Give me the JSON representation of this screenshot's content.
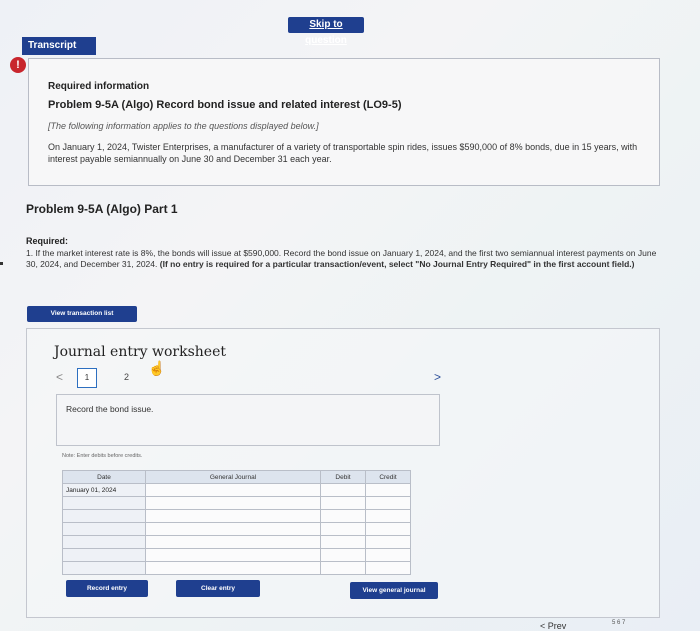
{
  "header": {
    "skip_label": "Skip to question"
  },
  "transcript": {
    "label": "Transcript",
    "alert": "!"
  },
  "info": {
    "heading": "Required information",
    "problem_title": "Problem 9-5A (Algo) Record bond issue and related interest (LO9-5)",
    "note": "[The following information applies to the questions displayed below.]",
    "paragraph": "On January 1, 2024, Twister Enterprises, a manufacturer of a variety of transportable spin rides, issues $590,000 of 8% bonds, due in 15 years, with interest payable semiannually on June 30 and December 31 each year."
  },
  "part": {
    "title": "Problem 9-5A (Algo) Part 1"
  },
  "required": {
    "label": "Required:",
    "text": "1. If the market interest rate is 8%, the bonds will issue at $590,000. Record the bond issue on January 1, 2024, and the first two semiannual interest payments on June 30, 2024, and December 31, 2024.",
    "bold_text": "(If no entry is required for a particular transaction/event, select \"No Journal Entry Required\" in the first account field.)"
  },
  "buttons": {
    "view_transaction_list": "View transaction list",
    "record_entry": "Record entry",
    "clear_entry": "Clear entry",
    "view_general_journal": "View general journal"
  },
  "worksheet": {
    "title": "Journal entry worksheet",
    "nav_prev": "<",
    "nav_next": ">",
    "page_current": "1",
    "page_next": "2",
    "instruction": "Record the bond issue.",
    "note": "Note: Enter debits before credits."
  },
  "journal_table": {
    "headers": [
      "Date",
      "General Journal",
      "Debit",
      "Credit"
    ],
    "rows": [
      [
        "January 01, 2024",
        "",
        "",
        ""
      ],
      [
        "",
        "",
        "",
        ""
      ],
      [
        "",
        "",
        "",
        ""
      ],
      [
        "",
        "",
        "",
        ""
      ],
      [
        "",
        "",
        "",
        ""
      ],
      [
        "",
        "",
        "",
        ""
      ],
      [
        "",
        "",
        "",
        ""
      ]
    ]
  },
  "footer": {
    "prev_label": "Prev",
    "page_info": "5  6  7"
  }
}
